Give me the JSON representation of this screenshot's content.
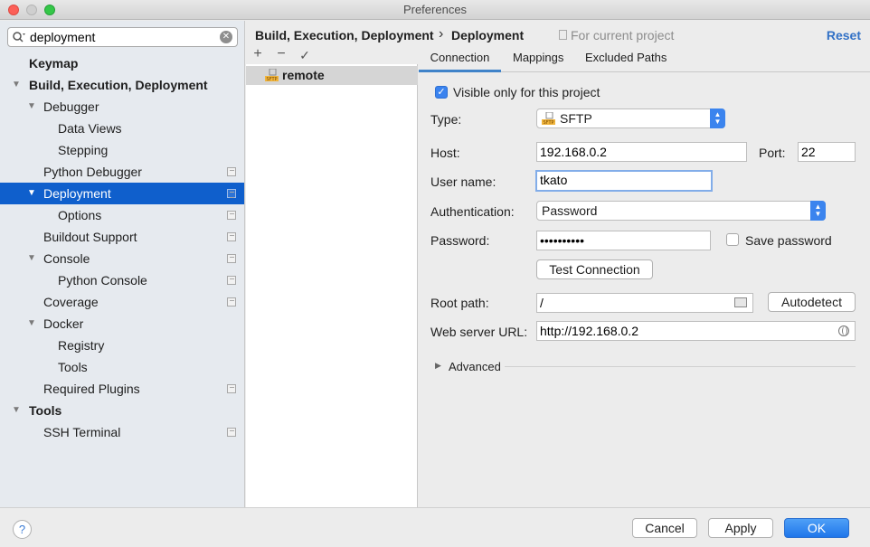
{
  "window": {
    "title": "Preferences"
  },
  "search": {
    "value": "deployment"
  },
  "tree": [
    {
      "label": "Keymap"
    },
    {
      "label": "Build, Execution, Deployment"
    },
    {
      "label": "Debugger"
    },
    {
      "label": "Data Views"
    },
    {
      "label": "Stepping"
    },
    {
      "label": "Python Debugger"
    },
    {
      "label": "Deployment"
    },
    {
      "label": "Options"
    },
    {
      "label": "Buildout Support"
    },
    {
      "label": "Console"
    },
    {
      "label": "Python Console"
    },
    {
      "label": "Coverage"
    },
    {
      "label": "Docker"
    },
    {
      "label": "Registry"
    },
    {
      "label": "Tools"
    },
    {
      "label": "Required Plugins"
    },
    {
      "label": "Tools"
    },
    {
      "label": "SSH Terminal"
    }
  ],
  "breadcrumb": {
    "parent": "Build, Execution, Deployment",
    "separator": "›",
    "current": "Deployment",
    "scope": "For current project",
    "reset": "Reset"
  },
  "toolbar": {
    "add": "+",
    "remove": "−",
    "default": "✓"
  },
  "servers": [
    {
      "name": "remote",
      "icon": "sftp-server-icon"
    }
  ],
  "tabs": [
    {
      "label": "Connection"
    },
    {
      "label": "Mappings"
    },
    {
      "label": "Excluded Paths"
    }
  ],
  "form": {
    "visible_only": "Visible only for this project",
    "type_label": "Type:",
    "type_value": "SFTP",
    "host_label": "Host:",
    "host_value": "192.168.0.2",
    "port_label": "Port:",
    "port_value": "22",
    "user_label": "User name:",
    "user_value": "tkato",
    "auth_label": "Authentication:",
    "auth_value": "Password",
    "password_label": "Password:",
    "password_value": "••••••••••",
    "save_password": "Save password",
    "test_connection": "Test Connection",
    "root_label": "Root path:",
    "root_value": "/",
    "autodetect": "Autodetect",
    "url_label": "Web server URL:",
    "url_value": "http://192.168.0.2",
    "advanced": "Advanced"
  },
  "footer": {
    "help": "?",
    "cancel": "Cancel",
    "apply": "Apply",
    "ok": "OK"
  },
  "colors": {
    "accent": "#0f5fcc",
    "link": "#3271c6",
    "primary_button": "#1f76ea",
    "checkbox": "#3a83ef"
  }
}
